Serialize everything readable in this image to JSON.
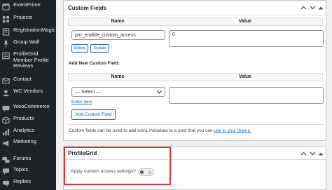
{
  "sidebar": {
    "items": [
      {
        "label": "EventPrime",
        "icon": "calendar-icon"
      },
      {
        "label": "Projects",
        "icon": "projects-icon"
      },
      {
        "label": "RegistrationMagic",
        "icon": "registration-magic-icon"
      },
      {
        "label": "Group Wall",
        "icon": "pushpin-icon"
      },
      {
        "label": "ProfileGrid Member Profile Reviews",
        "icon": "reviews-icon"
      },
      {
        "label": "Contact",
        "icon": "envelope-icon"
      },
      {
        "label": "WC Vendors",
        "icon": "vendors-icon"
      },
      {
        "label": "WooCommerce",
        "icon": "woocommerce-icon"
      },
      {
        "label": "Products",
        "icon": "products-icon"
      },
      {
        "label": "Analytics",
        "icon": "analytics-icon"
      },
      {
        "label": "Marketing",
        "icon": "megaphone-icon"
      },
      {
        "label": "Forums",
        "icon": "forums-icon"
      },
      {
        "label": "Topics",
        "icon": "topics-icon"
      },
      {
        "label": "Replies",
        "icon": "replies-icon"
      }
    ]
  },
  "custom_fields": {
    "title": "Custom Fields",
    "headers": {
      "name": "Name",
      "value": "Value"
    },
    "existing": {
      "name": "pm_enable_custom_access",
      "value": "0",
      "delete_label": "Delete",
      "update_label": "Update"
    },
    "add_new_label": "Add New Custom Field:",
    "select_placeholder": "— Select —",
    "enter_new_label": "Enter new",
    "add_button_label": "Add Custom Field",
    "help_text": "Custom fields can be used to add extra metadata to a post that you can",
    "help_link": "use in your theme."
  },
  "profilegrid": {
    "title": "ProfileGrid",
    "apply_label": "Apply custom access settings?",
    "toggle_on": false,
    "highlight_color": "#d63638"
  },
  "colors": {
    "sidebar_bg": "#1d2327",
    "link": "#2271b1"
  }
}
